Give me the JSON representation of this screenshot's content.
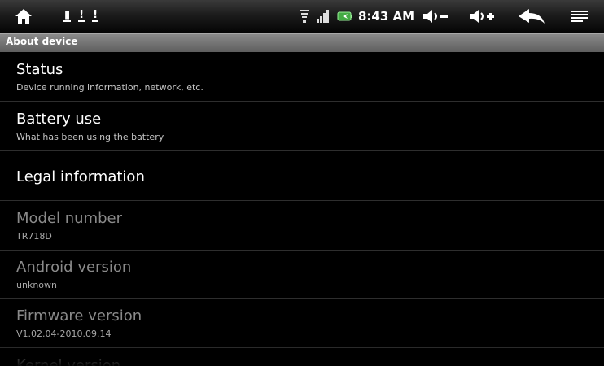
{
  "status_bar": {
    "time": "8:43 AM",
    "icons": [
      "home-icon",
      "notification-icon",
      "usb-icon",
      "alert-icon",
      "wifi-icon",
      "signal-icon",
      "battery-icon",
      "volume-down-icon",
      "volume-up-icon",
      "back-icon",
      "menu-icon"
    ]
  },
  "header": {
    "title": "About device"
  },
  "items": [
    {
      "title": "Status",
      "summary": "Device running information, network, etc."
    },
    {
      "title": "Battery use",
      "summary": "What has been using the battery"
    },
    {
      "title": "Legal information"
    },
    {
      "title": "Model number",
      "summary": "TR718D"
    },
    {
      "title": "Android version",
      "summary": "unknown"
    },
    {
      "title": "Firmware version",
      "summary": "V1.02.04-2010.09.14"
    },
    {
      "title": "Kernel version"
    }
  ]
}
